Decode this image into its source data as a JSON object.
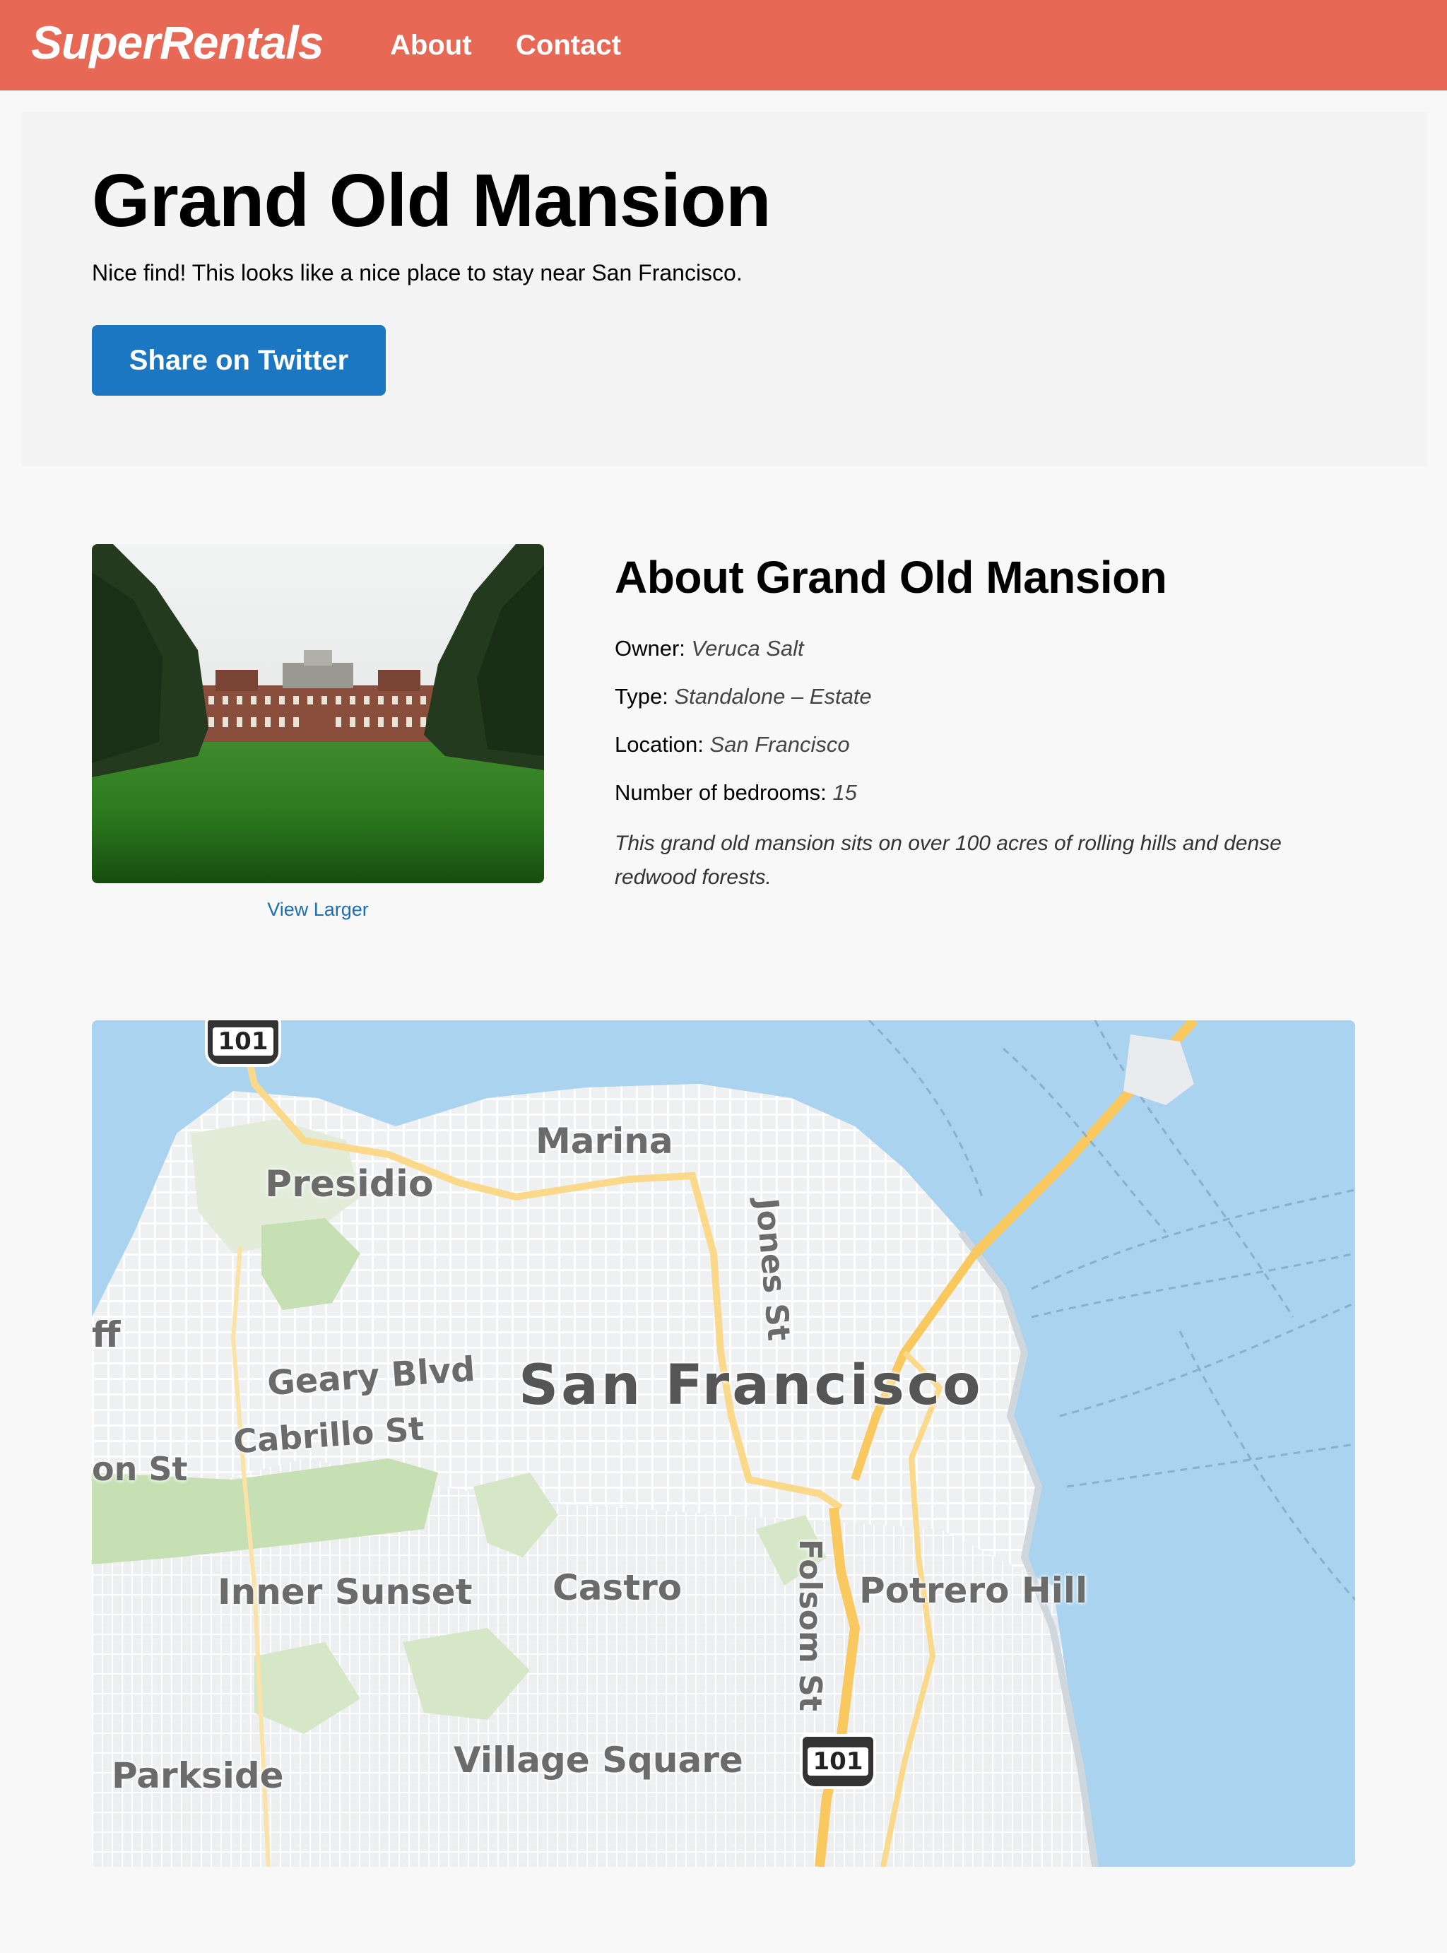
{
  "nav": {
    "brand": "SuperRentals",
    "about": "About",
    "contact": "Contact"
  },
  "jumbo": {
    "title": "Grand Old Mansion",
    "message": "Nice find! This looks like a nice place to stay near San Francisco.",
    "share_button": "Share on Twitter"
  },
  "rental": {
    "view_larger": "View Larger",
    "heading": "About Grand Old Mansion",
    "owner_label": "Owner:",
    "owner": "Veruca Salt",
    "type_label": "Type:",
    "type": "Standalone – Estate",
    "location_label": "Location:",
    "location": "San Francisco",
    "bedrooms_label": "Number of bedrooms:",
    "bedrooms": "15",
    "description": "This grand old mansion sits on over 100 acres of rolling hills and dense redwood forests."
  },
  "map": {
    "labels": {
      "city": "San Francisco",
      "marina": "Marina",
      "presidio": "Presidio",
      "jones": "Jones St",
      "geary": "Geary Blvd",
      "cabrillo": "Cabrillo St",
      "on_st": "on St",
      "ff": "ff",
      "inner_sunset": "Inner Sunset",
      "castro": "Castro",
      "folsom": "Folsom St",
      "potrero": "Potrero Hill",
      "parkside": "Parkside",
      "village_square": "Village Square",
      "hwy_top": "101",
      "hwy_bottom": "101"
    }
  },
  "colors": {
    "brand": "#e76855",
    "button": "#1c77c3",
    "link": "#1c6fb5",
    "water": "#a9d3ee"
  }
}
